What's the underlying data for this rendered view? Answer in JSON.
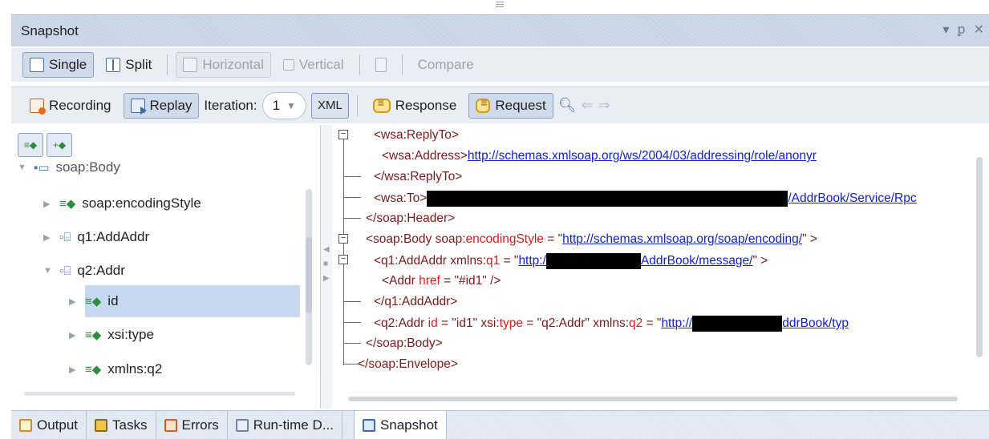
{
  "window": {
    "title": "Snapshot",
    "controls": [
      "▾",
      "ꝑ",
      "✕"
    ]
  },
  "toolbar1": {
    "single": "Single",
    "split": "Split",
    "horizontal": "Horizontal",
    "vertical": "Vertical",
    "compare": "Compare"
  },
  "toolbar2": {
    "recording": "Recording",
    "replay": "Replay",
    "iteration_label": "Iteration:",
    "iteration_value": "1",
    "xml": "XML",
    "response": "Response",
    "request": "Request"
  },
  "tree": {
    "items": [
      {
        "label": "soap:Body"
      },
      {
        "label": "soap:encodingStyle"
      },
      {
        "label": "q1:AddAddr"
      },
      {
        "label": "q2:Addr"
      },
      {
        "label": "id"
      },
      {
        "label": "xsi:type"
      },
      {
        "label": "xmlns:q2"
      }
    ]
  },
  "xml": {
    "l1_tag": "<wsa:ReplyTo>",
    "l2_open": "<wsa:Address>",
    "l2_link": "http://schemas.xmlsoap.org/ws/2004/03/addressing/role/anonyr",
    "l3_tag": "</wsa:ReplyTo>",
    "l4_open": "<wsa:To>",
    "l4_tail": "/AddrBook/Service/Rpc",
    "l5_tag": "</soap:Header>",
    "l6_open": "<soap:Body soap:",
    "l6_attr": "encodingStyle",
    "l6_eq": " = \"",
    "l6_link": "http://schemas.xmlsoap.org/soap/encoding/",
    "l6_close": "\" >",
    "l7_open": "<q1:AddAddr xmlns:",
    "l7_attr": "q1",
    "l7_eq": " = \"",
    "l7_link_a": "http:/",
    "l7_link_b": "AddrBook/message/",
    "l7_close": "\" >",
    "l8_open": "<Addr ",
    "l8_attr": "href",
    "l8_rest": " = \"#id1\" />",
    "l9_tag": "</q1:AddAddr>",
    "l10_open": "<q2:Addr ",
    "l10_attr1": "id",
    "l10_v1": " = \"id1\" xsi:",
    "l10_attr2": "type",
    "l10_v2": " = \"q2:Addr\" xmlns:",
    "l10_attr3": "q2",
    "l10_eq3": " = \"",
    "l10_link_a": "http://",
    "l10_link_b": "ddrBook/typ",
    "l11_tag": "</soap:Body>",
    "l12_tag": "</soap:Envelope>"
  },
  "bottom_tabs": [
    {
      "label": "Output"
    },
    {
      "label": "Tasks"
    },
    {
      "label": "Errors"
    },
    {
      "label": "Run-time D..."
    },
    {
      "label": "Snapshot"
    }
  ]
}
